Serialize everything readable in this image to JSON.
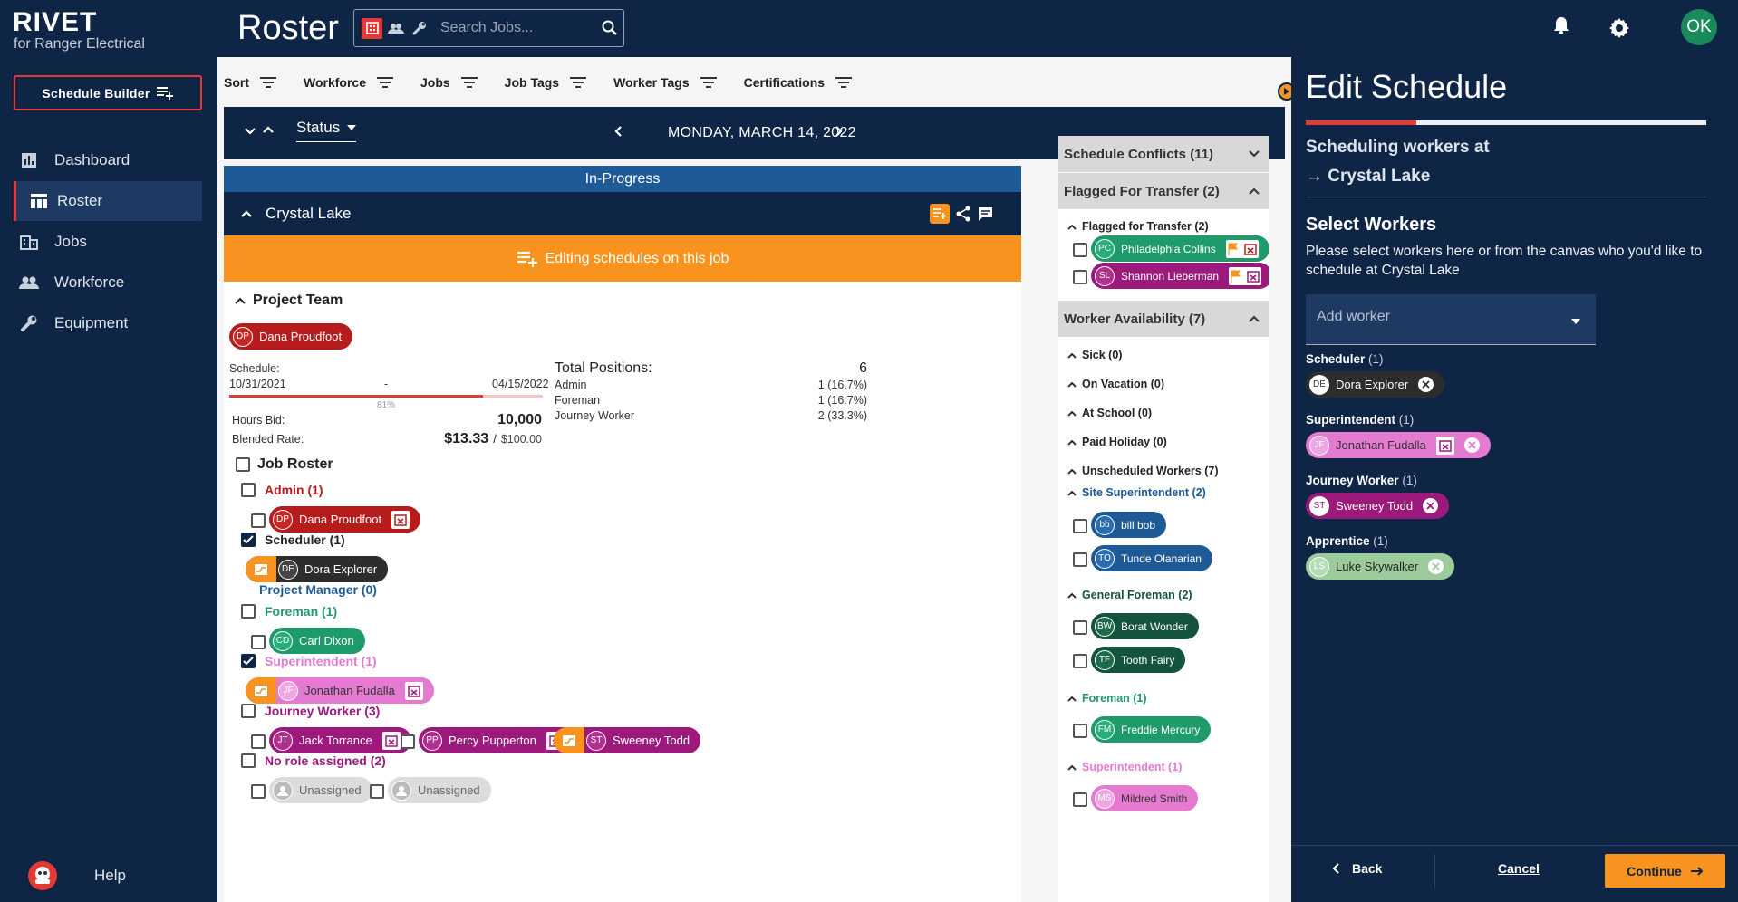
{
  "brand": {
    "name": "RIVET",
    "sub": "for Ranger Electrical"
  },
  "sidebar": {
    "schedule_builder": "Schedule Builder",
    "items": [
      {
        "label": "Dashboard",
        "icon": "chart-icon"
      },
      {
        "label": "Roster",
        "icon": "table-icon"
      },
      {
        "label": "Jobs",
        "icon": "building-icon"
      },
      {
        "label": "Workforce",
        "icon": "people-icon"
      },
      {
        "label": "Equipment",
        "icon": "wrench-icon"
      }
    ],
    "help": "Help"
  },
  "header": {
    "title": "Roster",
    "search_placeholder": "Search Jobs...",
    "user_initials": "OK"
  },
  "filters": {
    "sort": "Sort",
    "workforce": "Workforce",
    "jobs": "Jobs",
    "job_tags": "Job Tags",
    "worker_tags": "Worker Tags",
    "certifications": "Certifications"
  },
  "datebar": {
    "status": "Status",
    "date": "MONDAY, MARCH 14, 2022"
  },
  "job": {
    "status_banner": "In-Progress",
    "name": "Crystal Lake",
    "editing_banner": "Editing schedules on this job",
    "project_team_label": "Project Team",
    "project_team_member": {
      "initials": "DP",
      "name": "Dana Proudfoot"
    },
    "schedule_label": "Schedule:",
    "start_date": "10/31/2021",
    "dash": "-",
    "end_date": "04/15/2022",
    "progress_pct": "81%",
    "progress_value": 0.81,
    "hours_bid_label": "Hours Bid:",
    "hours_bid": "10,000",
    "blended_rate_label": "Blended Rate:",
    "blended_rate": "$13.33",
    "blended_rate_sep": "/",
    "blended_rate_max": "$100.00",
    "total_positions_label": "Total Positions:",
    "total_positions": "6",
    "positions": [
      {
        "role": "Admin",
        "value": "1 (16.7%)"
      },
      {
        "role": "Foreman",
        "value": "1 (16.7%)"
      },
      {
        "role": "Journey Worker",
        "value": "2 (33.3%)"
      }
    ],
    "job_roster_label": "Job Roster",
    "roles": {
      "admin": {
        "label": "Admin (1)",
        "workers": [
          {
            "initials": "DP",
            "name": "Dana Proudfoot"
          }
        ]
      },
      "scheduler": {
        "label": "Scheduler (1)",
        "workers": [
          {
            "initials": "DE",
            "name": "Dora Explorer"
          }
        ]
      },
      "project_manager": {
        "label": "Project Manager (0)"
      },
      "foreman": {
        "label": "Foreman (1)",
        "workers": [
          {
            "initials": "CD",
            "name": "Carl Dixon"
          }
        ]
      },
      "superintendent": {
        "label": "Superintendent (1)",
        "workers": [
          {
            "initials": "JF",
            "name": "Jonathan Fudalla"
          }
        ]
      },
      "journey": {
        "label": "Journey Worker (3)",
        "workers": [
          {
            "initials": "JT",
            "name": "Jack Torrance"
          },
          {
            "initials": "PP",
            "name": "Percy Pupperton"
          },
          {
            "initials": "ST",
            "name": "Sweeney Todd"
          }
        ]
      },
      "no_role": {
        "label": "No role assigned (2)",
        "workers": [
          {
            "name": "Unassigned"
          },
          {
            "name": "Unassigned"
          }
        ]
      }
    }
  },
  "right": {
    "conflicts": "Schedule Conflicts (11)",
    "flagged": "Flagged For Transfer (2)",
    "flagged_sub": "Flagged for Transfer (2)",
    "flagged_workers": [
      {
        "initials": "PC",
        "name": "Philadelphia Collins"
      },
      {
        "initials": "SL",
        "name": "Shannon Lieberman"
      }
    ],
    "availability": "Worker Availability (7)",
    "avail_groups": [
      "Sick (0)",
      "On Vacation (0)",
      "At School (0)",
      "Paid Holiday (0)",
      "Unscheduled Workers (7)"
    ],
    "site_super": "Site Superintendent (2)",
    "site_super_workers": [
      {
        "initials": "bb",
        "name": "bill bob"
      },
      {
        "initials": "TO",
        "name": "Tunde Olanarian"
      }
    ],
    "gen_foreman": "General Foreman (2)",
    "gen_foreman_workers": [
      {
        "initials": "BW",
        "name": "Borat Wonder"
      },
      {
        "initials": "TF",
        "name": "Tooth Fairy"
      }
    ],
    "foreman": "Foreman (1)",
    "foreman_workers": [
      {
        "initials": "FM",
        "name": "Freddie Mercury"
      }
    ],
    "superintendent": "Superintendent (1)",
    "superintendent_workers": [
      {
        "initials": "MS",
        "name": "Mildred Smith"
      }
    ]
  },
  "edit": {
    "title": "Edit Schedule",
    "sub1": "Scheduling workers at",
    "sub2_arrow": "→",
    "sub2": "Crystal Lake",
    "select_title": "Select Workers",
    "desc": "Please select workers here or from the canvas who you'd like to schedule at Crystal Lake",
    "add_worker": "Add worker",
    "roles": [
      {
        "label": "Scheduler",
        "count": "(1)",
        "worker": {
          "initials": "DE",
          "name": "Dora Explorer"
        }
      },
      {
        "label": "Superintendent",
        "count": "(1)",
        "worker": {
          "initials": "JF",
          "name": "Jonathan Fudalla"
        }
      },
      {
        "label": "Journey Worker",
        "count": "(1)",
        "worker": {
          "initials": "ST",
          "name": "Sweeney Todd"
        }
      },
      {
        "label": "Apprentice",
        "count": "(1)",
        "worker": {
          "initials": "LS",
          "name": "Luke Skywalker"
        }
      }
    ],
    "back": "Back",
    "cancel": "Cancel",
    "continue": "Continue"
  },
  "colors": {
    "navy": "#0f2545",
    "orange": "#f7931e",
    "red": "#e53935",
    "admin": "#b71c1c",
    "scheduler": "#2d2d2d",
    "foreman": "#1f9a6a",
    "superintendent": "#e57bd1",
    "journey": "#9c1a7c",
    "apprentice": "#9ccc9c",
    "site_super": "#1e5a96",
    "gen_foreman": "#14543c"
  }
}
